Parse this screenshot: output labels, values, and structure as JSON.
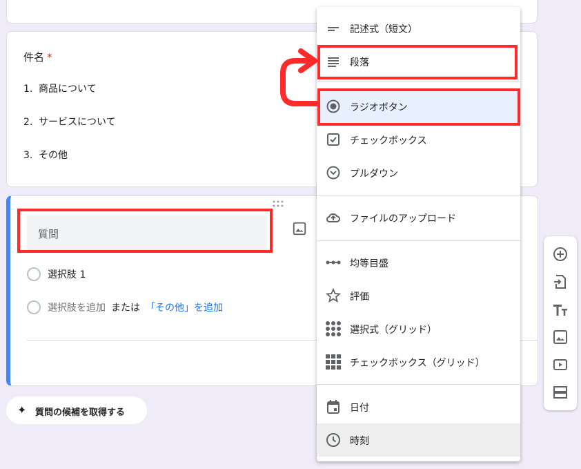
{
  "question1": {
    "title": "件名",
    "required_mark": "*",
    "options": [
      {
        "num": "1.",
        "text": "商品について"
      },
      {
        "num": "2.",
        "text": "サービスについて"
      },
      {
        "num": "3.",
        "text": "その他"
      }
    ]
  },
  "question2": {
    "placeholder": "質問",
    "choice1": "選択肢 1",
    "add_choice": "選択肢を追加",
    "or": "または",
    "add_other": "「その他」を追加"
  },
  "suggest": {
    "icon": "sparkle-icon",
    "label": "質問の候補を取得する"
  },
  "menu": {
    "items": [
      {
        "label": "記述式（短文）",
        "icon": "short-text-icon"
      },
      {
        "label": "段落",
        "icon": "paragraph-icon"
      },
      {
        "label": "ラジオボタン",
        "icon": "radio-button-icon"
      },
      {
        "label": "チェックボックス",
        "icon": "checkbox-icon"
      },
      {
        "label": "プルダウン",
        "icon": "dropdown-icon"
      },
      {
        "label": "ファイルのアップロード",
        "icon": "cloud-upload-icon"
      },
      {
        "label": "均等目盛",
        "icon": "linear-scale-icon"
      },
      {
        "label": "評価",
        "icon": "star-icon"
      },
      {
        "label": "選択式（グリッド）",
        "icon": "radio-grid-icon"
      },
      {
        "label": "チェックボックス（グリッド）",
        "icon": "checkbox-grid-icon"
      },
      {
        "label": "日付",
        "icon": "calendar-icon"
      },
      {
        "label": "時刻",
        "icon": "clock-icon"
      }
    ]
  },
  "sidebar": {
    "buttons": [
      "add-question-icon",
      "import-questions-icon",
      "add-title-icon",
      "add-image-icon",
      "add-video-icon",
      "add-section-icon"
    ]
  },
  "colors": {
    "accent": "#4285f4",
    "highlight": "#ff2a2a",
    "selected": "#e8f0fe",
    "background": "#f0ebf8"
  }
}
